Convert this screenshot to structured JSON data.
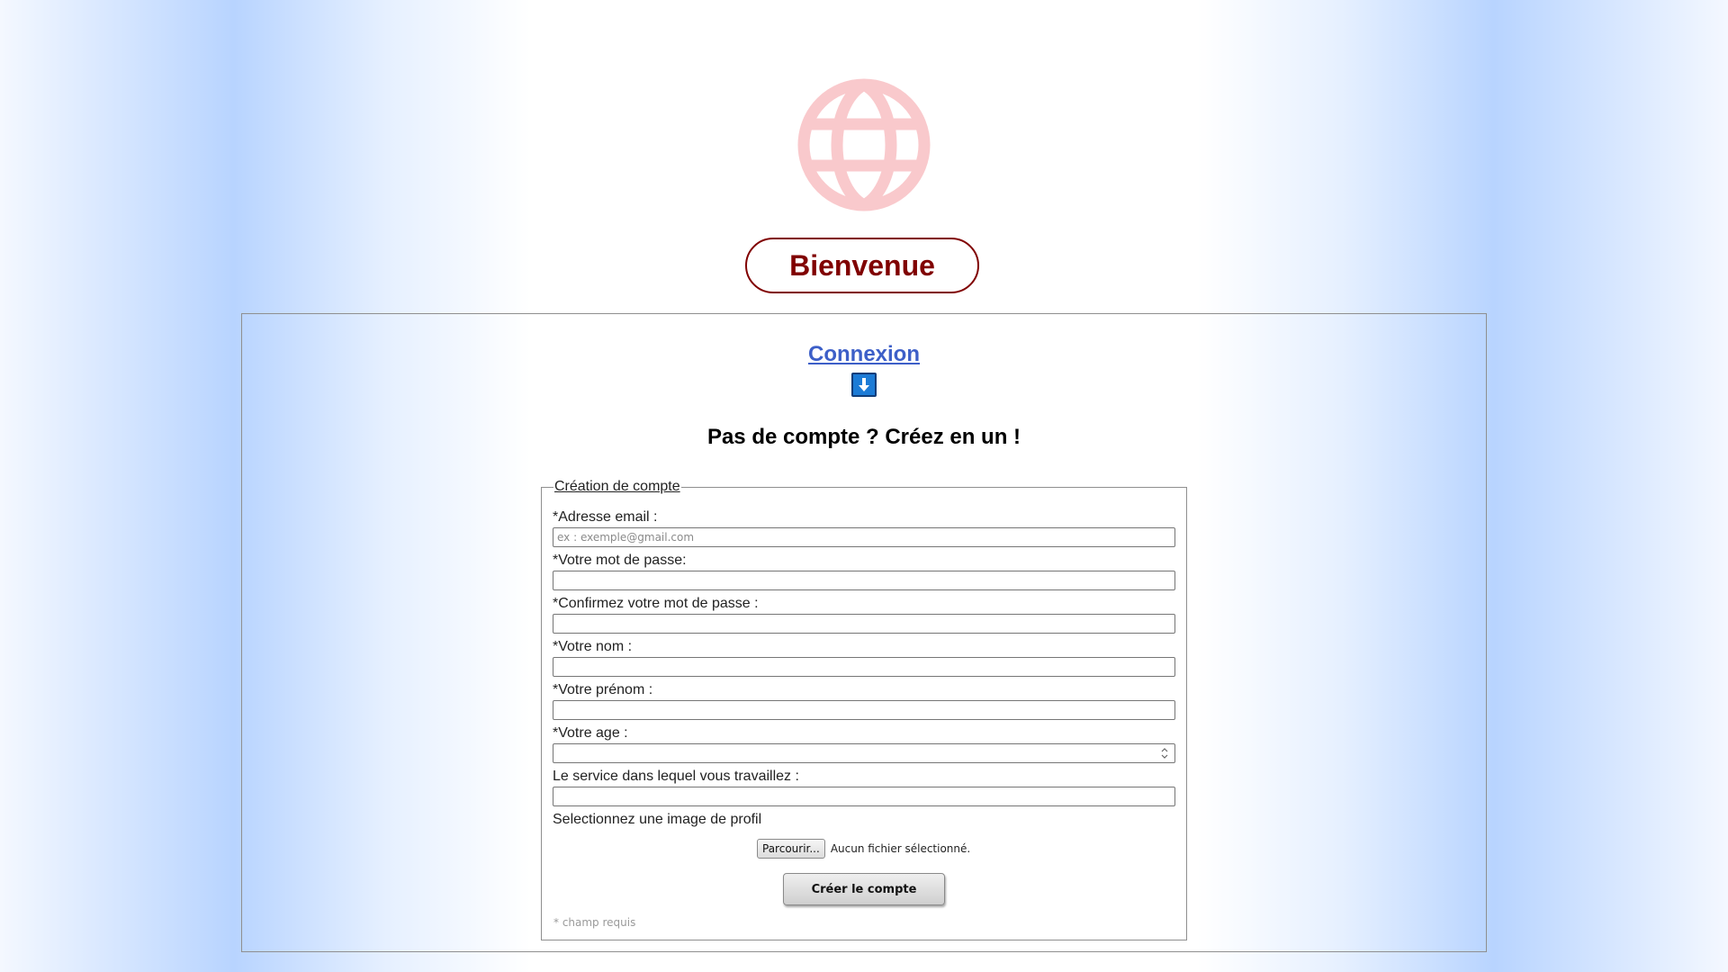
{
  "header": {
    "logo_icon": "globe-icon",
    "logo_color": "#f9c9cc",
    "welcome_label": "Bienvenue",
    "welcome_color": "#800000"
  },
  "login": {
    "link_label": "Connexion",
    "link_color": "#3d5fc8",
    "arrow_icon": "arrow-down-icon"
  },
  "signup": {
    "title": "Pas de compte ? Créez en un !",
    "legend": "Création de compte",
    "fields": [
      {
        "label": "*Adresse email :",
        "placeholder": "ex : exemple@gmail.com",
        "type": "email",
        "value": ""
      },
      {
        "label": "*Votre mot de passe:",
        "placeholder": "",
        "type": "password",
        "value": ""
      },
      {
        "label": "*Confirmez votre mot de passe :",
        "placeholder": "",
        "type": "password",
        "value": ""
      },
      {
        "label": "*Votre nom :",
        "placeholder": "",
        "type": "text",
        "value": ""
      },
      {
        "label": "*Votre prénom :",
        "placeholder": "",
        "type": "text",
        "value": ""
      },
      {
        "label": "*Votre age :",
        "placeholder": "",
        "type": "number",
        "value": ""
      },
      {
        "label": "Le service dans lequel vous travaillez :",
        "placeholder": "",
        "type": "text",
        "value": ""
      }
    ],
    "image_label": "Selectionnez une image de profil",
    "file_button_label": "Parcourir...",
    "file_status": "Aucun fichier sélectionné.",
    "submit_label": "Créer le compte",
    "required_note": "* champ requis"
  }
}
